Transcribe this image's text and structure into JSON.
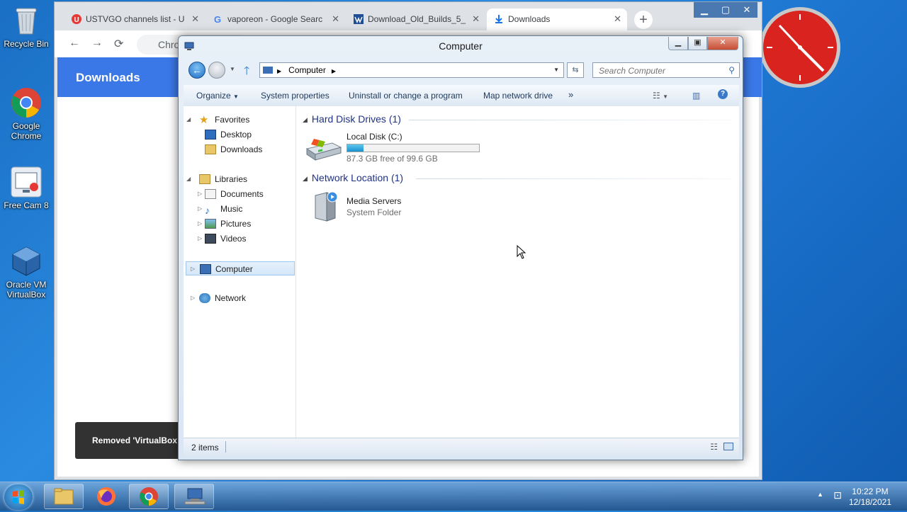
{
  "desktop": {
    "icons": [
      {
        "label": "Recycle Bin"
      },
      {
        "label": "Google Chrome"
      },
      {
        "label": "Free Cam 8"
      },
      {
        "label": "Oracle VM VirtualBox"
      }
    ]
  },
  "chrome": {
    "tabs": [
      {
        "title": "USTVGO channels list - U"
      },
      {
        "title": "vaporeon - Google Searc"
      },
      {
        "title": "Download_Old_Builds_5_"
      },
      {
        "title": "Downloads"
      }
    ],
    "omnibox_text": "Chro",
    "page_title": "Downloads",
    "toast": "Removed 'VirtualBox"
  },
  "explorer": {
    "title": "Computer",
    "address": "Computer",
    "search_placeholder": "Search Computer",
    "commands": {
      "organize": "Organize",
      "system_properties": "System properties",
      "uninstall": "Uninstall or change a program",
      "map_drive": "Map network drive",
      "more": "»"
    },
    "nav": {
      "favorites": "Favorites",
      "desktop": "Desktop",
      "downloads": "Downloads",
      "libraries": "Libraries",
      "documents": "Documents",
      "music": "Music",
      "pictures": "Pictures",
      "videos": "Videos",
      "computer": "Computer",
      "network": "Network"
    },
    "groups": {
      "hdd": "Hard Disk Drives (1)",
      "network": "Network Location (1)"
    },
    "drive": {
      "name": "Local Disk (C:)",
      "free": "87.3 GB free of 99.6 GB",
      "used_fraction": 0.124
    },
    "media": {
      "name": "Media Servers",
      "type": "System Folder"
    },
    "status": "2 items"
  },
  "taskbar": {
    "time": "10:22 PM",
    "date": "12/18/2021"
  }
}
